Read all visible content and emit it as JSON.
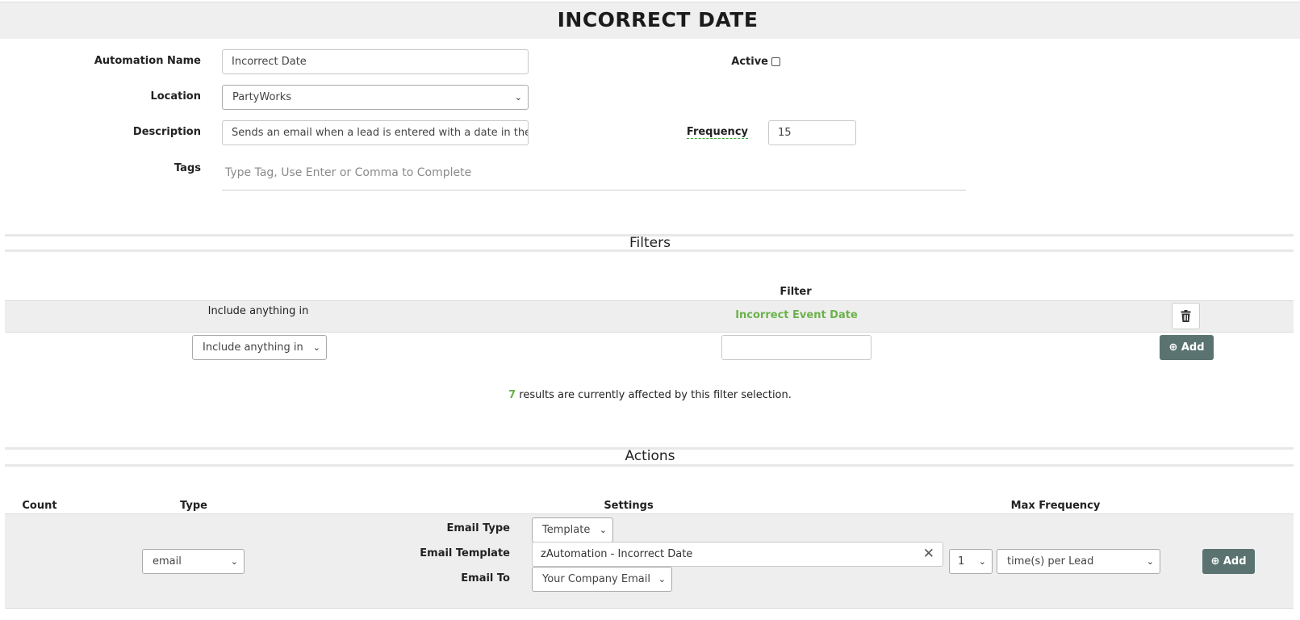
{
  "page": {
    "title": "INCORRECT DATE"
  },
  "form": {
    "automation_name_label": "Automation Name",
    "automation_name_value": "Incorrect Date",
    "active_label": "Active",
    "location_label": "Location",
    "location_value": "PartyWorks",
    "description_label": "Description",
    "description_value": "Sends an email when a lead is entered with a date in the",
    "frequency_label": "Frequency",
    "frequency_value": "15",
    "tags_label": "Tags",
    "tags_placeholder": "Type Tag, Use Enter or Comma to Complete"
  },
  "filters": {
    "section_title": "Filters",
    "column_filter": "Filter",
    "existing_row": {
      "mode": "Include anything in",
      "filter": "Incorrect Event Date"
    },
    "new_row": {
      "mode_select": "Include anything in",
      "filter_input": "",
      "add_label": "Add"
    },
    "results_count": "7",
    "results_text": "results are currently affected by this filter selection."
  },
  "actions": {
    "section_title": "Actions",
    "columns": {
      "count": "Count",
      "type": "Type",
      "settings": "Settings",
      "max_frequency": "Max Frequency"
    },
    "row": {
      "type_select": "email",
      "email_type_label": "Email Type",
      "email_type_value": "Template",
      "email_template_label": "Email Template",
      "email_template_value": "zAutomation - Incorrect Date",
      "email_to_label": "Email To",
      "email_to_value": "Your Company Email",
      "max_freq_count": "1",
      "max_freq_unit": "time(s) per Lead",
      "add_label": "Add"
    }
  },
  "colors": {
    "accent_green": "#6bb24a",
    "button_dark": "#5a7370",
    "row_bg": "#eeeeee"
  },
  "icons": [
    "trash-icon",
    "plus-circle-icon",
    "chevron-down-icon",
    "close-icon"
  ]
}
